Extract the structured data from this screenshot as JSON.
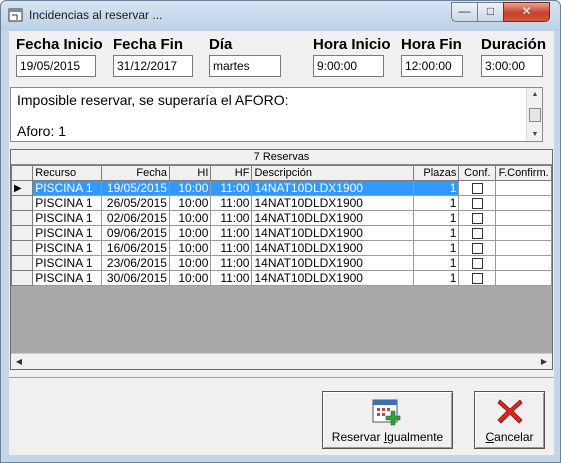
{
  "window": {
    "title": "Incidencias al reservar ...",
    "controls": {
      "minimize": "—",
      "maximize": "□",
      "close": "✕"
    }
  },
  "form": {
    "fecha_inicio": {
      "label": "Fecha Inicio",
      "value": "19/05/2015"
    },
    "fecha_fin": {
      "label": "Fecha Fin",
      "value": "31/12/2017"
    },
    "dia": {
      "label": "Día",
      "value": "martes"
    },
    "hora_inicio": {
      "label": "Hora Inicio",
      "value": "9:00:00"
    },
    "hora_fin": {
      "label": "Hora Fin",
      "value": "12:00:00"
    },
    "duracion": {
      "label": "Duración",
      "value": "3:00:00"
    }
  },
  "message": {
    "line1": "Imposible reservar, se superaría el AFORO:",
    "line2": "Aforo: 1"
  },
  "grid": {
    "caption": "7 Reservas",
    "columns": [
      "Recurso",
      "Fecha",
      "HI",
      "HF",
      "Descripción",
      "Plazas",
      "Conf.",
      "F.Confirm."
    ],
    "current_row_marker": "▶",
    "rows": [
      {
        "recurso": "PISCINA 1",
        "fecha": "19/05/2015",
        "hi": "10:00",
        "hf": "11:00",
        "descripcion": "14NAT10DLDX1900",
        "plazas": "1",
        "conf": false,
        "fconfirm": "",
        "selected": true
      },
      {
        "recurso": "PISCINA 1",
        "fecha": "26/05/2015",
        "hi": "10:00",
        "hf": "11:00",
        "descripcion": "14NAT10DLDX1900",
        "plazas": "1",
        "conf": false,
        "fconfirm": "",
        "selected": false
      },
      {
        "recurso": "PISCINA 1",
        "fecha": "02/06/2015",
        "hi": "10:00",
        "hf": "11:00",
        "descripcion": "14NAT10DLDX1900",
        "plazas": "1",
        "conf": false,
        "fconfirm": "",
        "selected": false
      },
      {
        "recurso": "PISCINA 1",
        "fecha": "09/06/2015",
        "hi": "10:00",
        "hf": "11:00",
        "descripcion": "14NAT10DLDX1900",
        "plazas": "1",
        "conf": false,
        "fconfirm": "",
        "selected": false
      },
      {
        "recurso": "PISCINA 1",
        "fecha": "16/06/2015",
        "hi": "10:00",
        "hf": "11:00",
        "descripcion": "14NAT10DLDX1900",
        "plazas": "1",
        "conf": false,
        "fconfirm": "",
        "selected": false
      },
      {
        "recurso": "PISCINA 1",
        "fecha": "23/06/2015",
        "hi": "10:00",
        "hf": "11:00",
        "descripcion": "14NAT10DLDX1900",
        "plazas": "1",
        "conf": false,
        "fconfirm": "",
        "selected": false
      },
      {
        "recurso": "PISCINA 1",
        "fecha": "30/06/2015",
        "hi": "10:00",
        "hf": "11:00",
        "descripcion": "14NAT10DLDX1900",
        "plazas": "1",
        "conf": false,
        "fconfirm": "",
        "selected": false
      }
    ]
  },
  "scroll": {
    "up": "▲",
    "down": "▼",
    "left": "◀",
    "right": "▶"
  },
  "buttons": {
    "reservar": {
      "pre": "Reservar ",
      "accel": "I",
      "post": "gualmente",
      "icon": "calendar-add-icon"
    },
    "cancelar": {
      "accel": "C",
      "post": "ancelar",
      "icon": "red-x-icon"
    }
  },
  "colors": {
    "selection": "#3399ff",
    "close_button": "#c8412b",
    "window_frame": "#c5d6e8"
  }
}
